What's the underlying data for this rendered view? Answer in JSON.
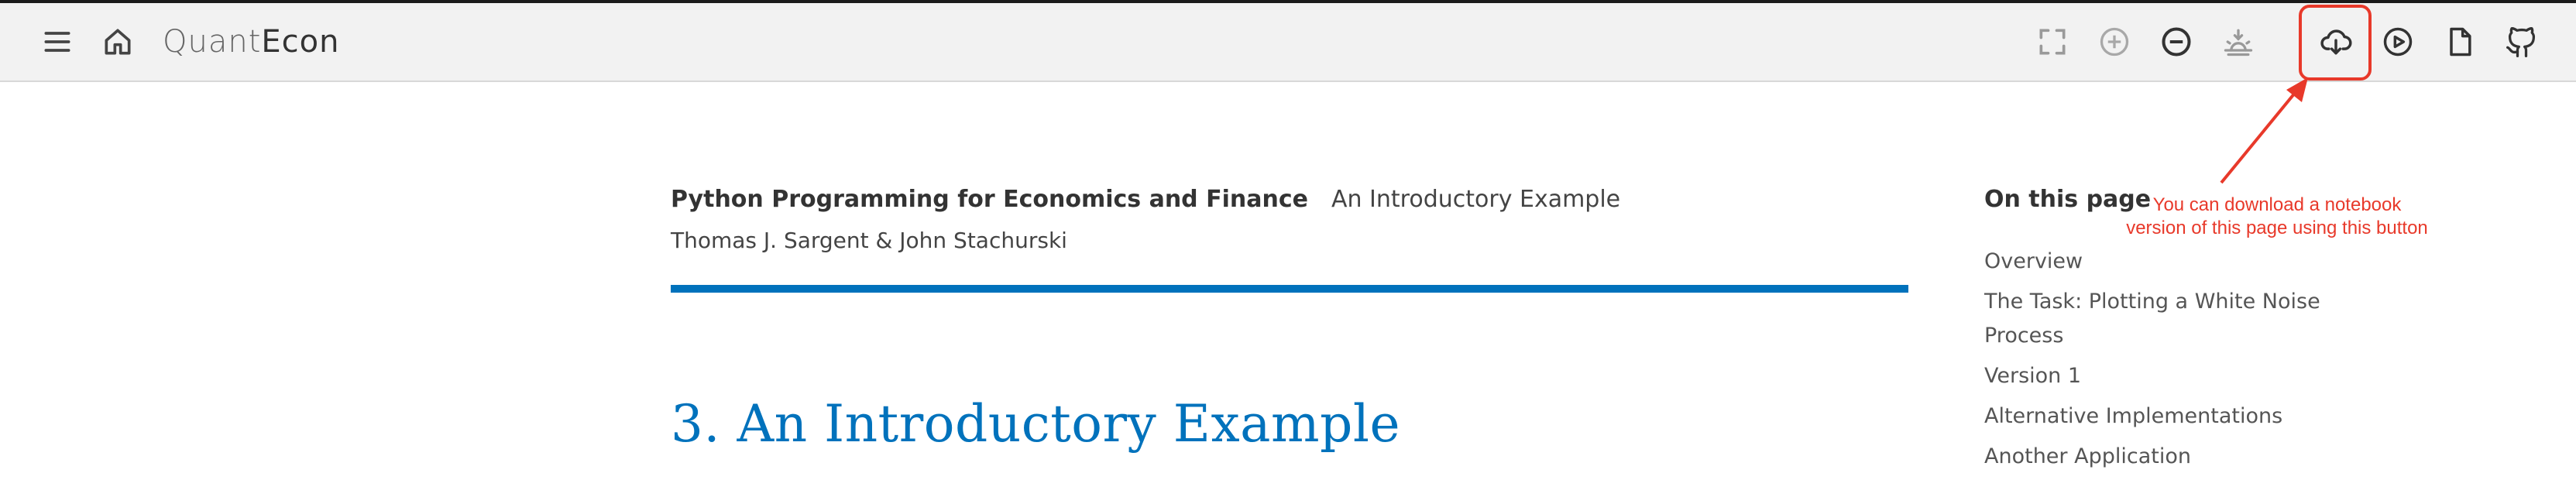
{
  "toolbar": {
    "brand_part1": "Quant",
    "brand_part2": "Econ",
    "icons": [
      "menu-icon",
      "home-icon",
      "fullscreen-icon",
      "zoom-in-icon",
      "zoom-out-icon",
      "theme-icon",
      "download-notebook-icon",
      "launch-notebook-icon",
      "pdf-icon",
      "github-icon"
    ]
  },
  "header": {
    "book_title": "Python Programming for Economics and Finance",
    "page_title": "An Introductory Example",
    "authors": "Thomas J. Sargent & John Stachurski"
  },
  "main": {
    "heading": "3. An Introductory Example"
  },
  "toc": {
    "title": "On this page",
    "items": [
      "Overview",
      "The Task: Plotting a White Noise Process",
      "Version 1",
      "Alternative Implementations",
      "Another Application"
    ]
  },
  "annotation": {
    "text": "You can download a notebook version of this page using this button",
    "color": "#e8392a"
  },
  "colors": {
    "accent": "#0072bc",
    "toolbar_bg": "#f2f2f2"
  }
}
